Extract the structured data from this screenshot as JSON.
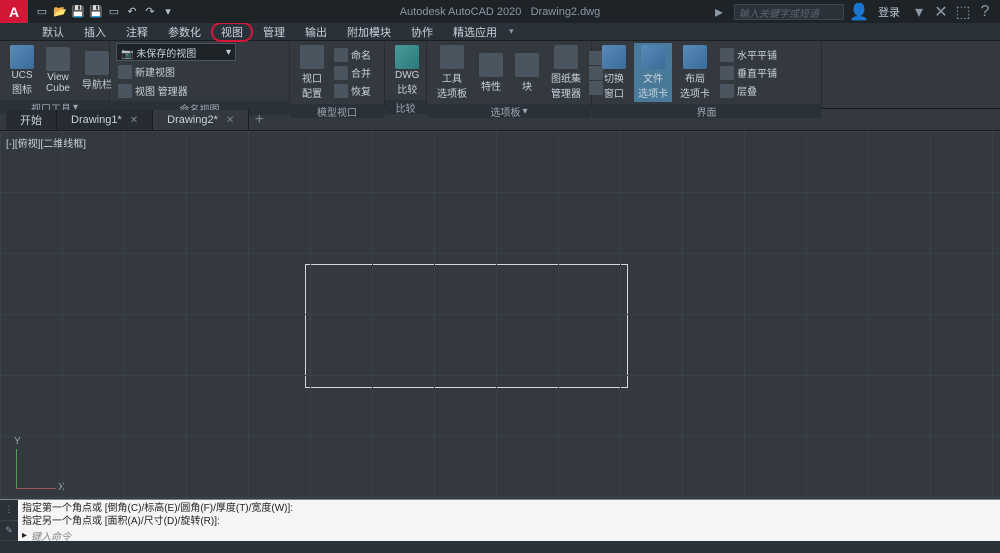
{
  "title": {
    "app": "Autodesk AutoCAD 2020",
    "doc": "Drawing2.dwg"
  },
  "search_placeholder": "输入关键字或短语",
  "login_label": "登录",
  "menu": [
    "默认",
    "插入",
    "注释",
    "参数化",
    "视图",
    "管理",
    "输出",
    "附加模块",
    "协作",
    "精选应用"
  ],
  "ribbon": {
    "panel1": {
      "ucs": "UCS\n图标",
      "viewcube": "View\nCube",
      "nav": "导航栏",
      "label": "视口工具"
    },
    "panel2": {
      "combo": "未保存的视图",
      "new_view": "新建视图",
      "view_mgr": "视图 管理器",
      "label": "命名视图"
    },
    "panel3": {
      "config": "视口\n配置",
      "naming": "命名",
      "merge": "合并",
      "restore": "恢复",
      "label": "模型视口"
    },
    "panel4": {
      "dwg": "DWG\n比较",
      "label": "比较"
    },
    "panel5": {
      "tool": "工具\n选项板",
      "prop": "特性",
      "block": "块",
      "sheet": "图纸集\n管理器",
      "label": "选项板"
    },
    "panel6": {
      "switch": "切换\n窗口",
      "filetab": "文件\n选项卡",
      "layout": "布局\n选项卡",
      "hsplit": "水平平铺",
      "vsplit": "垂直平铺",
      "cascade": "层叠",
      "label": "界面"
    }
  },
  "tabs": [
    {
      "name": "开始"
    },
    {
      "name": "Drawing1*"
    },
    {
      "name": "Drawing2*"
    }
  ],
  "view_label": "[-][俯视][二维线框]",
  "axis": {
    "x": "X",
    "y": "Y"
  },
  "cmd": {
    "l1": "指定第一个角点或 [倒角(C)/标高(E)/圆角(F)/厚度(T)/宽度(W)]:",
    "l2": "指定另一个角点或 [面积(A)/尺寸(D)/旋转(R)]:",
    "prompt": "键入命令"
  }
}
